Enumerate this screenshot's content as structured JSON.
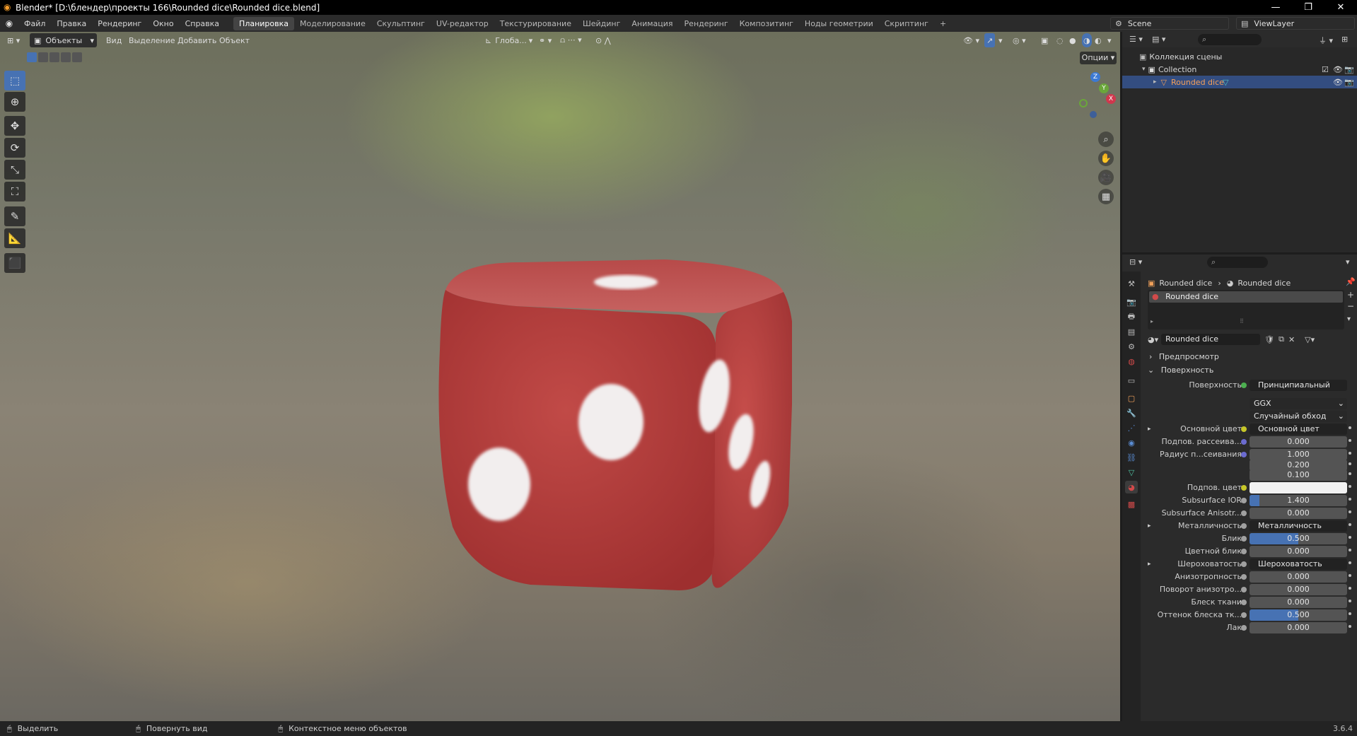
{
  "window": {
    "title": "Blender* [D:\\блендер\\проекты 166\\Rounded dice\\Rounded dice.blend]",
    "minimize": "—",
    "maximize": "❐",
    "close": "✕"
  },
  "menu": [
    "Файл",
    "Правка",
    "Рендеринг",
    "Окно",
    "Справка"
  ],
  "workspaces": [
    "Планировка",
    "Моделирование",
    "Скульптинг",
    "UV-редактор",
    "Текстурирование",
    "Шейдинг",
    "Анимация",
    "Рендеринг",
    "Композитинг",
    "Ноды геометрии",
    "Скриптинг",
    "+"
  ],
  "active_workspace": "Планировка",
  "scene": {
    "name": "Scene",
    "view_layer": "ViewLayer"
  },
  "viewport": {
    "mode": "Объекты",
    "menus": [
      "Вид",
      "Выделение",
      "Добавить",
      "Объект"
    ],
    "orientation": "Глоба...",
    "options": "Опции",
    "gizmo": {
      "x": "X",
      "y": "Y",
      "z": "Z"
    }
  },
  "outliner": {
    "scene_collection": "Коллекция сцены",
    "collection": "Collection",
    "object": "Rounded dice"
  },
  "properties": {
    "breadcrumb_object": "Rounded dice",
    "breadcrumb_material": "Rounded dice",
    "slot": "Rounded dice",
    "material_name": "Rounded dice",
    "panel_preview": "Предпросмотр",
    "panel_surface": "Поверхность",
    "surface_label": "Поверхность",
    "surface_value": "Принципиальный BSDF",
    "distribution": "GGX",
    "subsurface_method": "Случайный обход",
    "rows": [
      {
        "label": "Основной цвет",
        "value": "Основной цвет",
        "kind": "link",
        "socket": "#c7c729",
        "expander": true
      },
      {
        "label": "Подпов. рассеива...",
        "value": "0.000",
        "kind": "num",
        "fill": 0,
        "socket": "#6b6bd0"
      },
      {
        "label": "Радиус п...сеивания",
        "value": "1.000",
        "kind": "num",
        "fill": 0,
        "socket": "#6b6bd0"
      },
      {
        "label": "",
        "value": "0.200",
        "kind": "num",
        "fill": 0
      },
      {
        "label": "",
        "value": "0.100",
        "kind": "num",
        "fill": 0
      },
      {
        "label": "Подпов. цвет",
        "value": "",
        "kind": "color",
        "socket": "#c7c729"
      },
      {
        "label": "Subsurface IOR",
        "value": "1.400",
        "kind": "num",
        "fill": 0.1,
        "socket": "#a1a1a1"
      },
      {
        "label": "Subsurface Anisotr...",
        "value": "0.000",
        "kind": "num",
        "fill": 0,
        "socket": "#a1a1a1"
      },
      {
        "label": "Металличность",
        "value": "Металличность",
        "kind": "link",
        "socket": "#a1a1a1",
        "expander": true
      },
      {
        "label": "Блик",
        "value": "0.500",
        "kind": "num",
        "fill": 0.5,
        "socket": "#a1a1a1"
      },
      {
        "label": "Цветной блик",
        "value": "0.000",
        "kind": "num",
        "fill": 0,
        "socket": "#a1a1a1"
      },
      {
        "label": "Шероховатость",
        "value": "Шероховатость",
        "kind": "link",
        "socket": "#a1a1a1",
        "expander": true
      },
      {
        "label": "Анизотропность",
        "value": "0.000",
        "kind": "num",
        "fill": 0,
        "socket": "#a1a1a1"
      },
      {
        "label": "Поворот анизотро...",
        "value": "0.000",
        "kind": "num",
        "fill": 0,
        "socket": "#a1a1a1"
      },
      {
        "label": "Блеск ткани",
        "value": "0.000",
        "kind": "num",
        "fill": 0,
        "socket": "#a1a1a1"
      },
      {
        "label": "Оттенок блеска тк...",
        "value": "0.500",
        "kind": "num",
        "fill": 0.5,
        "socket": "#a1a1a1"
      },
      {
        "label": "Лак",
        "value": "0.000",
        "kind": "num",
        "fill": 0,
        "socket": "#a1a1a1"
      }
    ]
  },
  "statusbar": {
    "select": "Выделить",
    "rotate": "Повернуть вид",
    "context": "Контекстное меню объектов",
    "version": "3.6.4"
  },
  "colors": {
    "accent": "#4772b3",
    "dice": "#b33a3a",
    "selected_row": "#334d80"
  }
}
